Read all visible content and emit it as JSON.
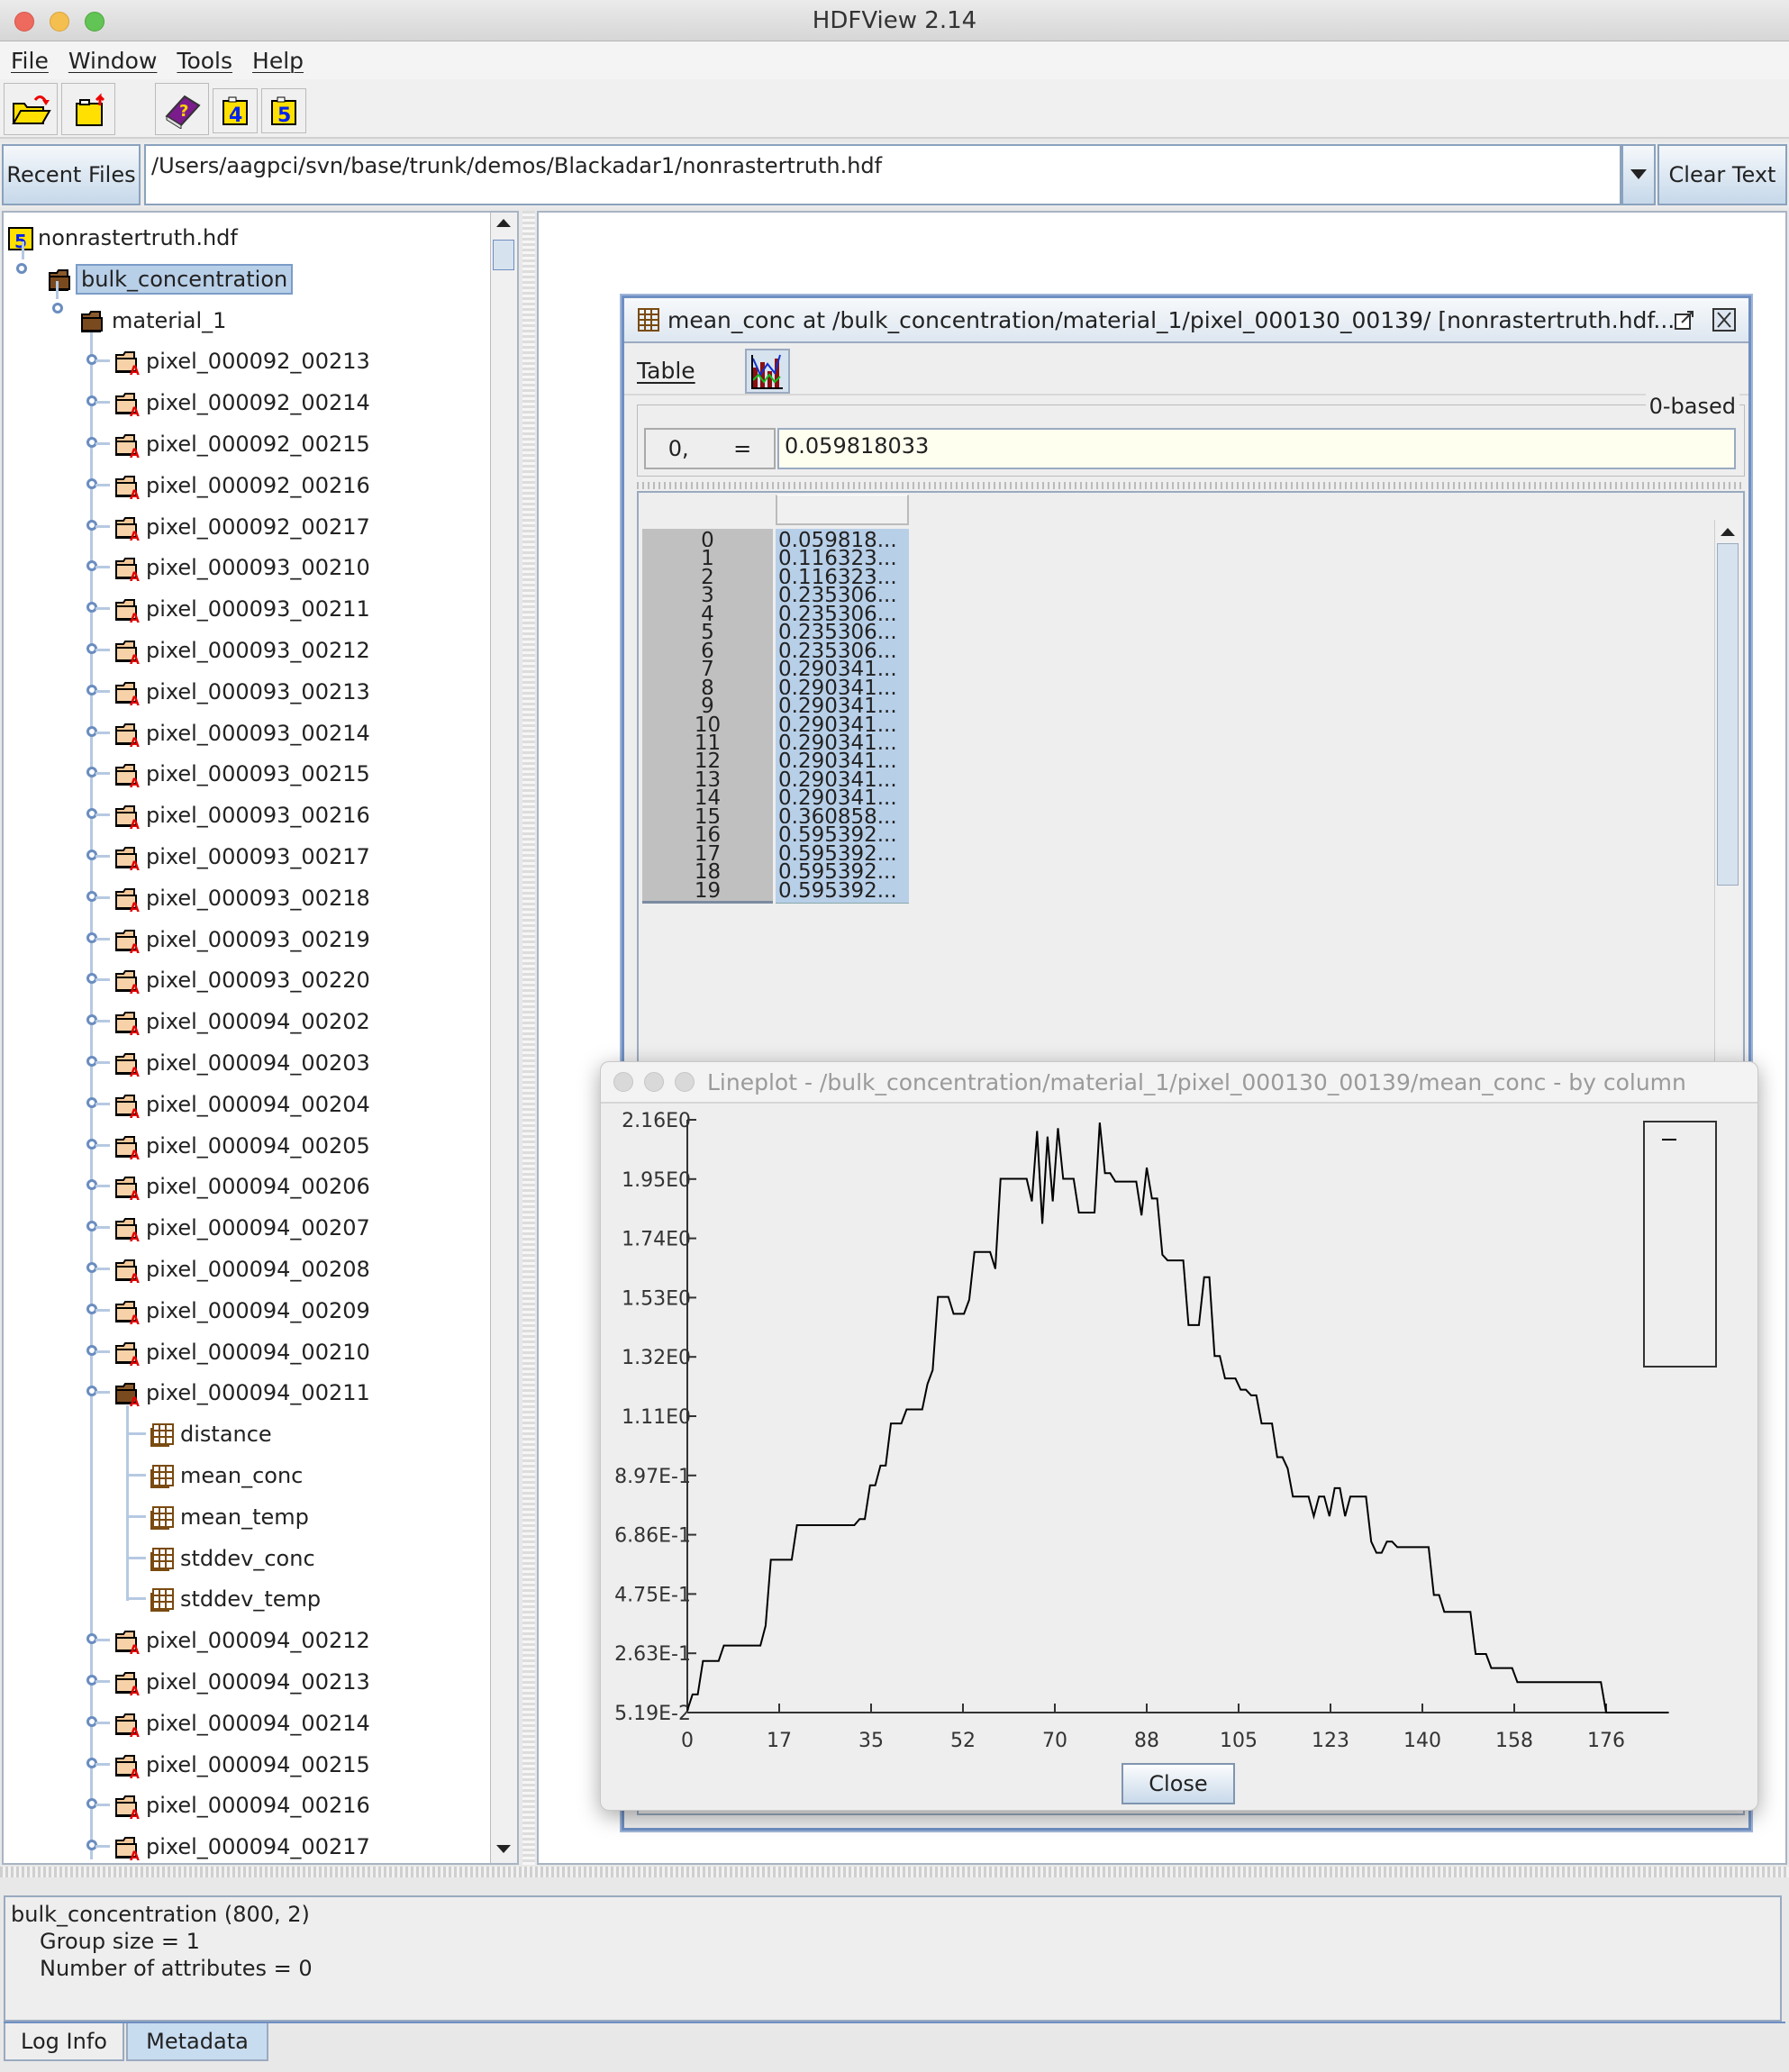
{
  "window": {
    "title": "HDFView 2.14"
  },
  "menu": [
    "File",
    "Window",
    "Tools",
    "Help"
  ],
  "toolbar": {
    "icons": [
      "open-file-icon",
      "close-file-icon",
      "help-book-icon",
      "hdf4-library-icon",
      "hdf5-library-icon"
    ]
  },
  "urlbar": {
    "recent_label": "Recent Files",
    "path": "/Users/aagpci/svn/base/trunk/demos/Blackadar1/nonrastertruth.hdf",
    "clear_label": "Clear Text"
  },
  "tree": {
    "root": "nonrastertruth.hdf",
    "group": "bulk_concentration",
    "subgroup": "material_1",
    "pixels_before": [
      "pixel_000092_00213",
      "pixel_000092_00214",
      "pixel_000092_00215",
      "pixel_000092_00216",
      "pixel_000092_00217",
      "pixel_000093_00210",
      "pixel_000093_00211",
      "pixel_000093_00212",
      "pixel_000093_00213",
      "pixel_000093_00214",
      "pixel_000093_00215",
      "pixel_000093_00216",
      "pixel_000093_00217",
      "pixel_000093_00218",
      "pixel_000093_00219",
      "pixel_000093_00220",
      "pixel_000094_00202",
      "pixel_000094_00203",
      "pixel_000094_00204",
      "pixel_000094_00205",
      "pixel_000094_00206",
      "pixel_000094_00207",
      "pixel_000094_00208",
      "pixel_000094_00209",
      "pixel_000094_00210"
    ],
    "expanded_pixel": "pixel_000094_00211",
    "datasets": [
      "distance",
      "mean_conc",
      "mean_temp",
      "stddev_conc",
      "stddev_temp"
    ],
    "pixels_after": [
      "pixel_000094_00212",
      "pixel_000094_00213",
      "pixel_000094_00214",
      "pixel_000094_00215",
      "pixel_000094_00216",
      "pixel_000094_00217"
    ]
  },
  "table_window": {
    "title": "mean_conc  at  /bulk_concentration/material_1/pixel_000130_00139/  [nonrastertruth.hdf...",
    "menu_table": "Table",
    "index_mode": "0-based",
    "cell_address": "0,",
    "cell_equals": "=",
    "cell_value": "0.059818033",
    "rows": [
      {
        "i": "0",
        "v": "0.059818..."
      },
      {
        "i": "1",
        "v": "0.116323..."
      },
      {
        "i": "2",
        "v": "0.116323..."
      },
      {
        "i": "3",
        "v": "0.235306..."
      },
      {
        "i": "4",
        "v": "0.235306..."
      },
      {
        "i": "5",
        "v": "0.235306..."
      },
      {
        "i": "6",
        "v": "0.235306..."
      },
      {
        "i": "7",
        "v": "0.290341..."
      },
      {
        "i": "8",
        "v": "0.290341..."
      },
      {
        "i": "9",
        "v": "0.290341..."
      },
      {
        "i": "10",
        "v": "0.290341..."
      },
      {
        "i": "11",
        "v": "0.290341..."
      },
      {
        "i": "12",
        "v": "0.290341..."
      },
      {
        "i": "13",
        "v": "0.290341..."
      },
      {
        "i": "14",
        "v": "0.290341..."
      },
      {
        "i": "15",
        "v": "0.360858..."
      },
      {
        "i": "16",
        "v": "0.595392..."
      },
      {
        "i": "17",
        "v": "0.595392..."
      },
      {
        "i": "18",
        "v": "0.595392..."
      },
      {
        "i": "19",
        "v": "0.595392..."
      }
    ]
  },
  "plot_window": {
    "title": "Lineplot - /bulk_concentration/material_1/pixel_000130_00139/mean_conc - by column",
    "close_label": "Close"
  },
  "chart_data": {
    "type": "line",
    "title": "",
    "xlabel": "",
    "ylabel": "",
    "xlim": [
      0,
      176
    ],
    "ylim": [
      0.0519,
      2.16
    ],
    "xticks": [
      "0",
      "17",
      "35",
      "52",
      "70",
      "88",
      "105",
      "123",
      "140",
      "158",
      "176"
    ],
    "yticks": [
      "5.19E-2",
      "2.63E-1",
      "4.75E-1",
      "6.86E-1",
      "8.97E-1",
      "1.11E0",
      "1.32E0",
      "1.53E0",
      "1.74E0",
      "1.95E0",
      "2.16E0"
    ],
    "legend": {
      "placement": "top-right",
      "entries": [
        "–"
      ]
    },
    "grid": false,
    "series": [
      {
        "name": "",
        "x_start": 0,
        "values": [
          0.0598,
          0.1163,
          0.1163,
          0.2353,
          0.2353,
          0.2353,
          0.2353,
          0.2903,
          0.2903,
          0.2903,
          0.2903,
          0.2903,
          0.2903,
          0.2903,
          0.2903,
          0.3609,
          0.5954,
          0.5954,
          0.5954,
          0.5954,
          0.5954,
          0.7183,
          0.7183,
          0.7183,
          0.7183,
          0.7183,
          0.7183,
          0.7183,
          0.7183,
          0.7183,
          0.7183,
          0.7183,
          0.7183,
          0.74,
          0.74,
          0.86,
          0.86,
          0.93,
          0.93,
          1.08,
          1.08,
          1.08,
          1.13,
          1.13,
          1.13,
          1.13,
          1.22,
          1.27,
          1.53,
          1.53,
          1.53,
          1.47,
          1.47,
          1.47,
          1.52,
          1.69,
          1.69,
          1.69,
          1.69,
          1.63,
          1.95,
          1.95,
          1.95,
          1.95,
          1.95,
          1.95,
          1.87,
          2.12,
          1.79,
          2.1,
          1.87,
          2.13,
          1.95,
          1.95,
          1.95,
          1.83,
          1.83,
          1.83,
          1.83,
          2.15,
          1.97,
          1.97,
          1.94,
          1.94,
          1.94,
          1.94,
          1.94,
          1.82,
          1.99,
          1.88,
          1.88,
          1.68,
          1.66,
          1.66,
          1.66,
          1.66,
          1.43,
          1.43,
          1.43,
          1.6,
          1.6,
          1.32,
          1.32,
          1.24,
          1.24,
          1.24,
          1.2,
          1.2,
          1.18,
          1.18,
          1.08,
          1.08,
          1.08,
          0.96,
          0.96,
          0.92,
          0.82,
          0.82,
          0.82,
          0.82,
          0.75,
          0.82,
          0.82,
          0.75,
          0.85,
          0.85,
          0.75,
          0.82,
          0.82,
          0.82,
          0.82,
          0.66,
          0.62,
          0.62,
          0.66,
          0.66,
          0.64,
          0.64,
          0.64,
          0.64,
          0.64,
          0.64,
          0.64,
          0.47,
          0.47,
          0.41,
          0.41,
          0.41,
          0.41,
          0.41,
          0.41,
          0.26,
          0.26,
          0.26,
          0.21,
          0.21,
          0.21,
          0.21,
          0.21,
          0.16,
          0.16,
          0.16,
          0.16,
          0.16,
          0.16,
          0.16,
          0.16,
          0.16,
          0.16,
          0.16,
          0.16,
          0.16,
          0.16,
          0.16,
          0.16,
          0.16,
          0.0519,
          0.0519,
          0.0519,
          0.0519,
          0.0519,
          0.0519,
          0.0519,
          0.0519,
          0.0519,
          0.0519,
          0.0519,
          0.0519,
          0.0519
        ]
      }
    ]
  },
  "metadata_panel": {
    "line1": "bulk_concentration (800, 2)",
    "line2": "Group size = 1",
    "line3": "Number of attributes = 0"
  },
  "bottom_tabs": [
    "Log Info",
    "Metadata"
  ]
}
